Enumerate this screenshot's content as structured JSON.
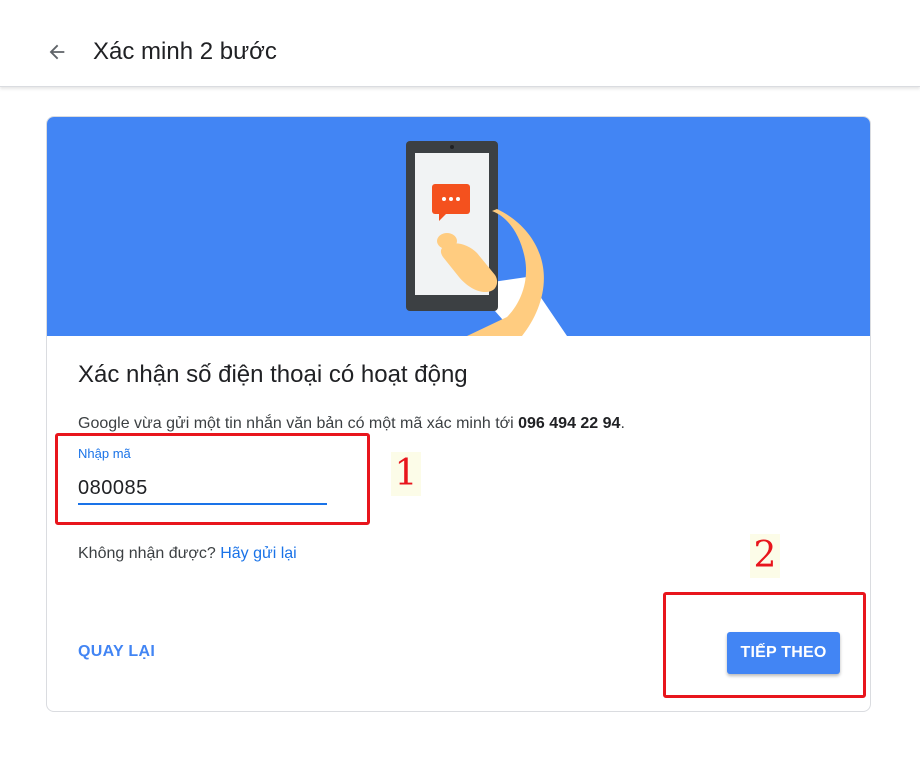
{
  "header": {
    "title": "Xác minh 2 bước",
    "back_icon": "arrow-left-icon"
  },
  "hero": {
    "background_color": "#4285f4",
    "illustration": "phone-with-message-icon"
  },
  "main": {
    "heading": "Xác nhận số điện thoại có hoạt động",
    "info_prefix": "Google vừa gửi một tin nhắn văn bản có một mã xác minh tới ",
    "phone_number": "096 494 22 94",
    "info_suffix": ".",
    "code_field": {
      "label": "Nhập mã",
      "value": "080085"
    },
    "resend_prompt": "Không nhận được?",
    "resend_link": "Hãy gửi lại"
  },
  "actions": {
    "back_label": "QUAY LẠI",
    "next_label": "TIẾP THEO"
  },
  "annotations": {
    "marker_1": "1",
    "marker_2": "2",
    "color": "#e8151c"
  },
  "colors": {
    "accent": "#4285f4",
    "link": "#1a73e8"
  }
}
